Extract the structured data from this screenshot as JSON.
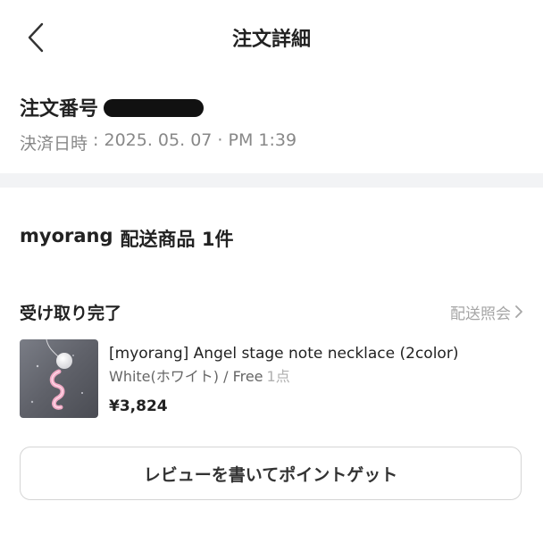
{
  "header": {
    "title": "注文詳細",
    "back_icon": "chevron-left-icon"
  },
  "order": {
    "number_label": "注文番号",
    "number_value_redacted": true,
    "paid_label": "決済日時",
    "paid_separator": " : ",
    "paid_date": "2025. 05. 07",
    "paid_dot": " · ",
    "paid_time": "PM 1:39"
  },
  "shipment": {
    "shop_name": "myorang",
    "heading_suffix": "配送商品 1件",
    "status": "受け取り完了",
    "tracking_link": "配送照会",
    "tracking_icon": "chevron-right-icon"
  },
  "product": {
    "name": "[myorang] Angel stage note necklace (2color)",
    "option": "White(ホワイト) / Free",
    "quantity": "1点",
    "price": "¥3,824"
  },
  "actions": {
    "review_button": "レビューを書いてポイントゲット"
  },
  "colors": {
    "text_primary": "#222222",
    "text_secondary": "#888888",
    "text_muted": "#a6a6a6",
    "divider": "#f2f3f5",
    "button_border": "#d5d5d5"
  }
}
